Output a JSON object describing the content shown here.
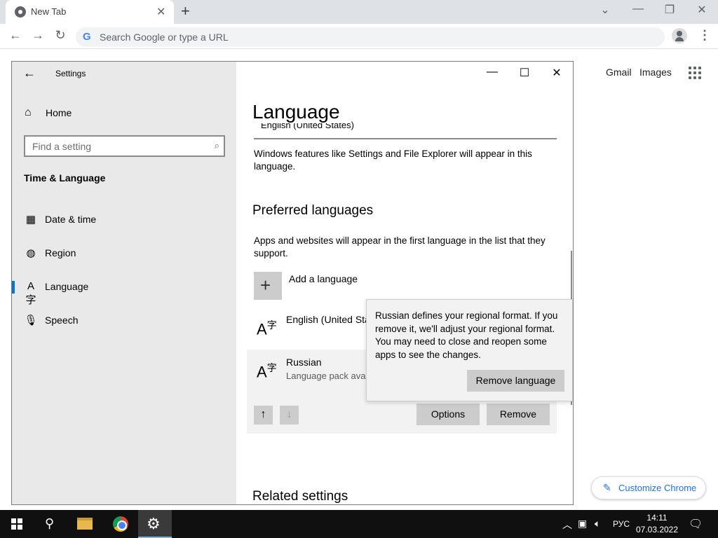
{
  "browser": {
    "tab_title": "New Tab",
    "tab_close": "✕",
    "new_tab": "+",
    "window_controls": [
      "⌄",
      "—",
      "❐",
      "✕"
    ],
    "omnibox_placeholder": "Search Google or type a URL",
    "ntp_links": [
      "Gmail",
      "Images"
    ],
    "customize_label": "Customize Chrome"
  },
  "settings": {
    "window_title": "Settings",
    "sidebar": {
      "home": "Home",
      "search_placeholder": "Find a setting",
      "section": "Time & Language",
      "items": [
        {
          "label": "Date & time",
          "icon": "calendar-clock-icon"
        },
        {
          "label": "Region",
          "icon": "globe-icon"
        },
        {
          "label": "Language",
          "icon": "language-icon",
          "active": true
        },
        {
          "label": "Speech",
          "icon": "microphone-icon"
        }
      ]
    },
    "main": {
      "title": "Language",
      "display_language_value": "English (United States)",
      "display_language_desc": "Windows features like Settings and File Explorer will appear in this language.",
      "preferred_heading": "Preferred languages",
      "preferred_desc": "Apps and websites will appear in the first language in the list that they support.",
      "add_language": "Add a language",
      "languages": [
        {
          "name": "English (United States)",
          "sub": ""
        },
        {
          "name": "Russian",
          "sub": "Language pack available"
        }
      ],
      "options_button": "Options",
      "remove_button": "Remove",
      "related_heading": "Related settings"
    },
    "flyout": {
      "message": "Russian defines your regional format. If you remove it, we'll adjust your regional format. You may need to close and reopen some apps to see the changes.",
      "confirm_button": "Remove language"
    }
  },
  "taskbar": {
    "language_indicator": "РУС",
    "time": "14:11",
    "date": "07.03.2022"
  }
}
